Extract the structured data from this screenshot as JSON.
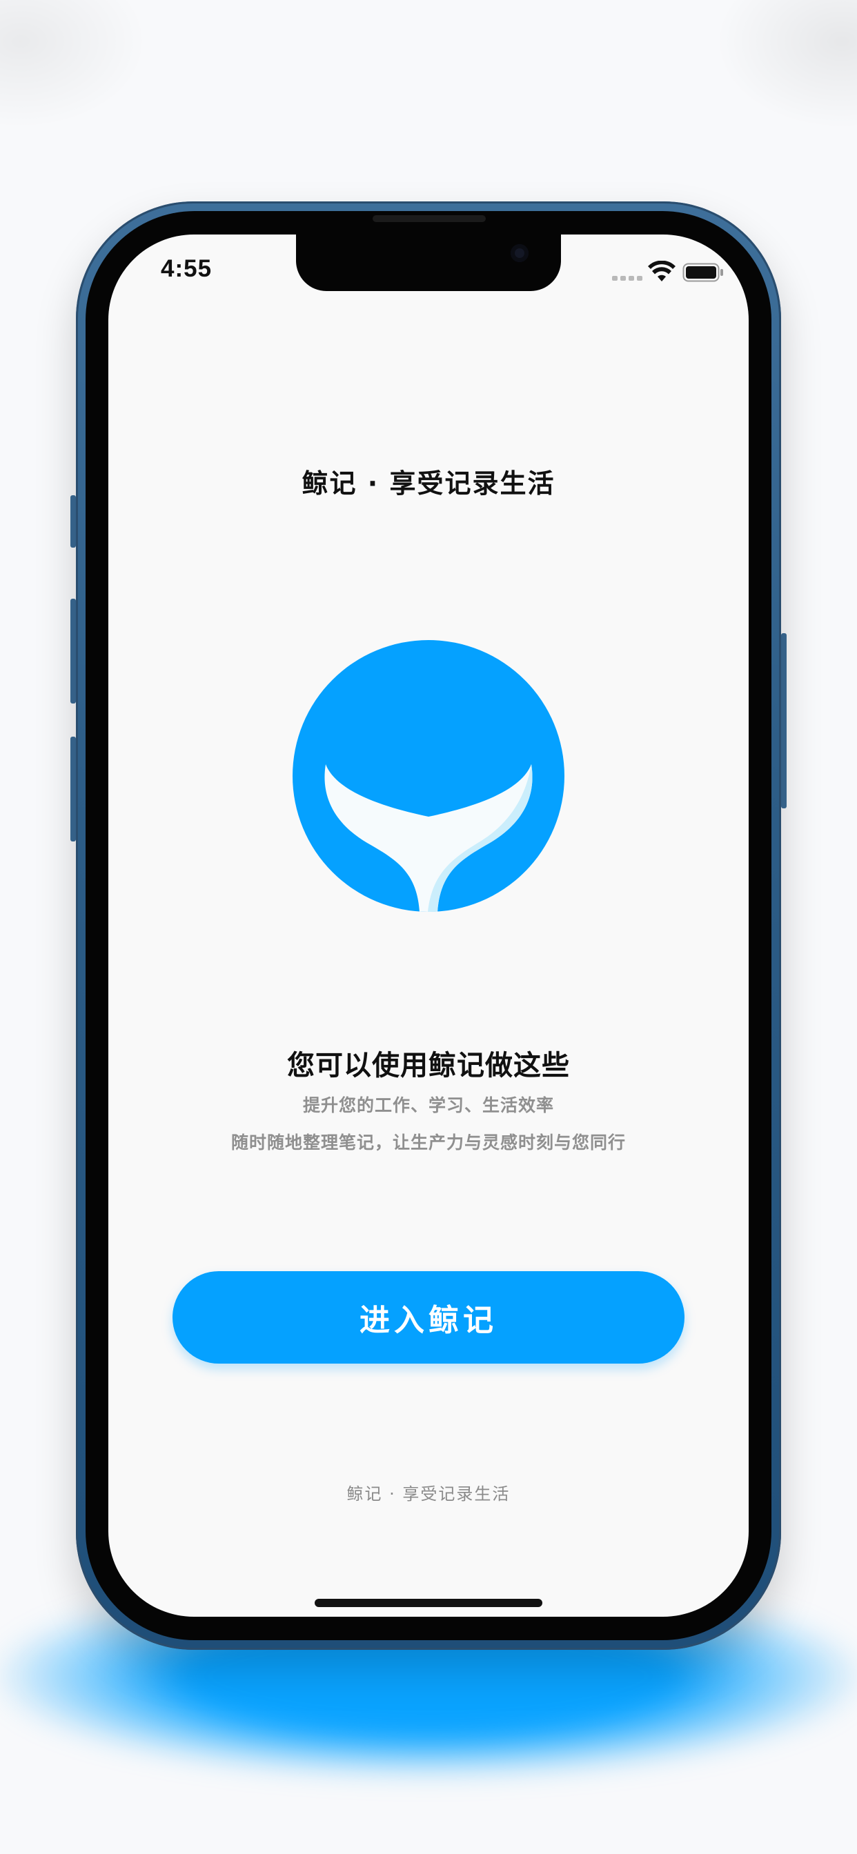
{
  "status_bar": {
    "time": "4:55",
    "wifi_icon": "wifi-icon",
    "battery_icon": "battery-icon"
  },
  "header": {
    "title": "鲸记 · 享受记录生活"
  },
  "logo": {
    "icon": "whale-tail-logo-icon",
    "color": "#05a1ff"
  },
  "features": {
    "title": "您可以使用鲸记做这些",
    "line1": "提升您的工作、学习、生活效率",
    "line2": "随时随地整理笔记，让生产力与灵感时刻与您同行"
  },
  "primary_action": {
    "label": "进入鲸记",
    "color": "#05a1ff"
  },
  "footer": {
    "text": "鲸记 · 享受记录生活"
  }
}
